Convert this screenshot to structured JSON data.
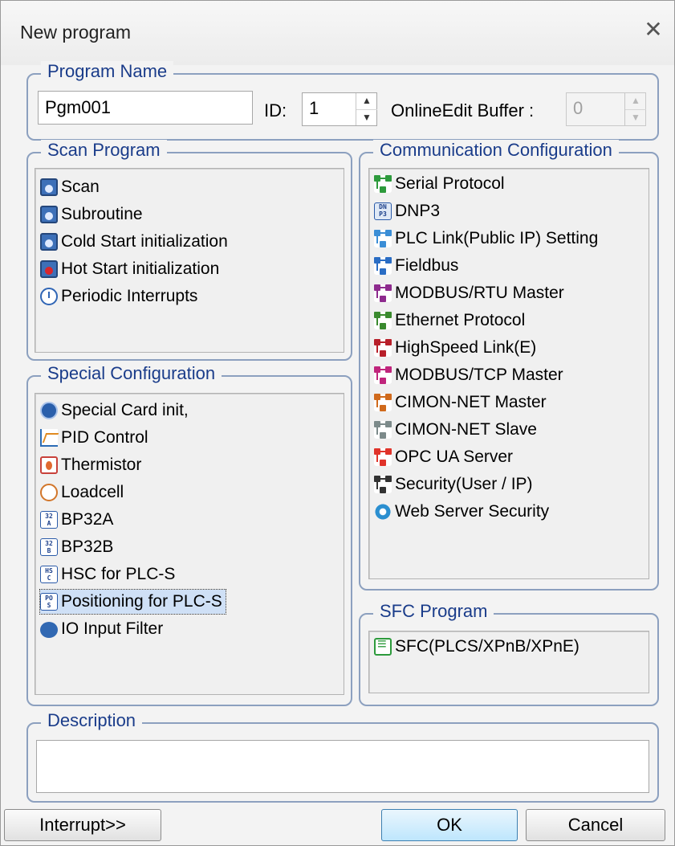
{
  "window": {
    "title": "New program",
    "close_glyph": "✕"
  },
  "program_name": {
    "group_title": "Program Name",
    "name_value": "Pgm001",
    "id_label": "ID:",
    "id_value": "1",
    "online_edit_label": "OnlineEdit Buffer :",
    "online_edit_value": "0"
  },
  "scan_program": {
    "group_title": "Scan Program",
    "items": [
      {
        "label": "Scan",
        "icon": "scan-icon"
      },
      {
        "label": "Subroutine",
        "icon": "subroutine-icon"
      },
      {
        "label": "Cold Start initialization",
        "icon": "cold-start-icon"
      },
      {
        "label": "Hot Start initialization",
        "icon": "hot-start-icon"
      },
      {
        "label": "Periodic Interrupts",
        "icon": "clock-icon"
      }
    ]
  },
  "special_configuration": {
    "group_title": "Special Configuration",
    "items": [
      {
        "label": "Special Card init,",
        "icon": "special-card-icon"
      },
      {
        "label": "PID Control",
        "icon": "pid-icon"
      },
      {
        "label": "Thermistor",
        "icon": "thermistor-icon"
      },
      {
        "label": "Loadcell",
        "icon": "loadcell-icon"
      },
      {
        "label": "BP32A",
        "icon": "bp32a-icon",
        "glyph": "32\nA"
      },
      {
        "label": "BP32B",
        "icon": "bp32b-icon",
        "glyph": "32\nB"
      },
      {
        "label": "HSC for PLC-S",
        "icon": "hsc-icon",
        "glyph": "HS\nC"
      },
      {
        "label": "Positioning for PLC-S",
        "icon": "positioning-icon",
        "glyph": "PO\nS",
        "selected": true
      },
      {
        "label": "IO Input Filter",
        "icon": "io-filter-icon"
      }
    ]
  },
  "communication_configuration": {
    "group_title": "Communication Configuration",
    "items": [
      {
        "label": "Serial Protocol",
        "icon": "serial-protocol-icon",
        "color": "#2d9a3c"
      },
      {
        "label": "DNP3",
        "icon": "dnp3-icon",
        "glyph": "DN\nP3"
      },
      {
        "label": "PLC Link(Public IP) Setting",
        "icon": "plc-link-icon",
        "color": "#3b8ed6"
      },
      {
        "label": "Fieldbus",
        "icon": "fieldbus-icon",
        "color": "#2a6dc4"
      },
      {
        "label": "MODBUS/RTU Master",
        "icon": "modbus-rtu-icon",
        "color": "#8e2b8e"
      },
      {
        "label": "Ethernet Protocol",
        "icon": "ethernet-icon",
        "color": "#3a8a2e"
      },
      {
        "label": "HighSpeed Link(E)",
        "icon": "highspeed-link-icon",
        "color": "#b8202a"
      },
      {
        "label": "MODBUS/TCP Master",
        "icon": "modbus-tcp-icon",
        "color": "#c0257c"
      },
      {
        "label": "CIMON-NET Master",
        "icon": "cimon-net-master-icon",
        "color": "#d06a1c"
      },
      {
        "label": "CIMON-NET Slave",
        "icon": "cimon-net-slave-icon",
        "color": "#7c8a8a"
      },
      {
        "label": "OPC UA Server",
        "icon": "opc-ua-icon",
        "color": "#e0332a"
      },
      {
        "label": "Security(User / IP)",
        "icon": "security-icon",
        "color": "#333333"
      },
      {
        "label": "Web Server Security",
        "icon": "web-server-gear-icon"
      }
    ]
  },
  "sfc_program": {
    "group_title": "SFC Program",
    "items": [
      {
        "label": "SFC(PLCS/XPnB/XPnE)",
        "icon": "sfc-icon"
      }
    ]
  },
  "description": {
    "group_title": "Description",
    "value": ""
  },
  "buttons": {
    "interrupt": "Interrupt>>",
    "ok": "OK",
    "cancel": "Cancel"
  }
}
